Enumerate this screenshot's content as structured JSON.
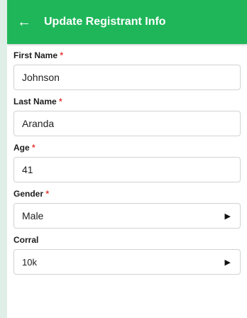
{
  "header": {
    "back_icon": "←",
    "title": "Update Registrant Info"
  },
  "colors": {
    "appbar": "#1fb65a",
    "required": "#e53935"
  },
  "form": {
    "required_mark": "*",
    "first_name": {
      "label": "First Name",
      "value": "Johnson"
    },
    "last_name": {
      "label": "Last Name",
      "value": "Aranda"
    },
    "age": {
      "label": "Age",
      "value": "41"
    },
    "gender": {
      "label": "Gender",
      "value": "Male",
      "dropdown_icon": "▶"
    },
    "corral": {
      "label": "Corral",
      "value": "10k",
      "dropdown_icon": "▶"
    }
  }
}
